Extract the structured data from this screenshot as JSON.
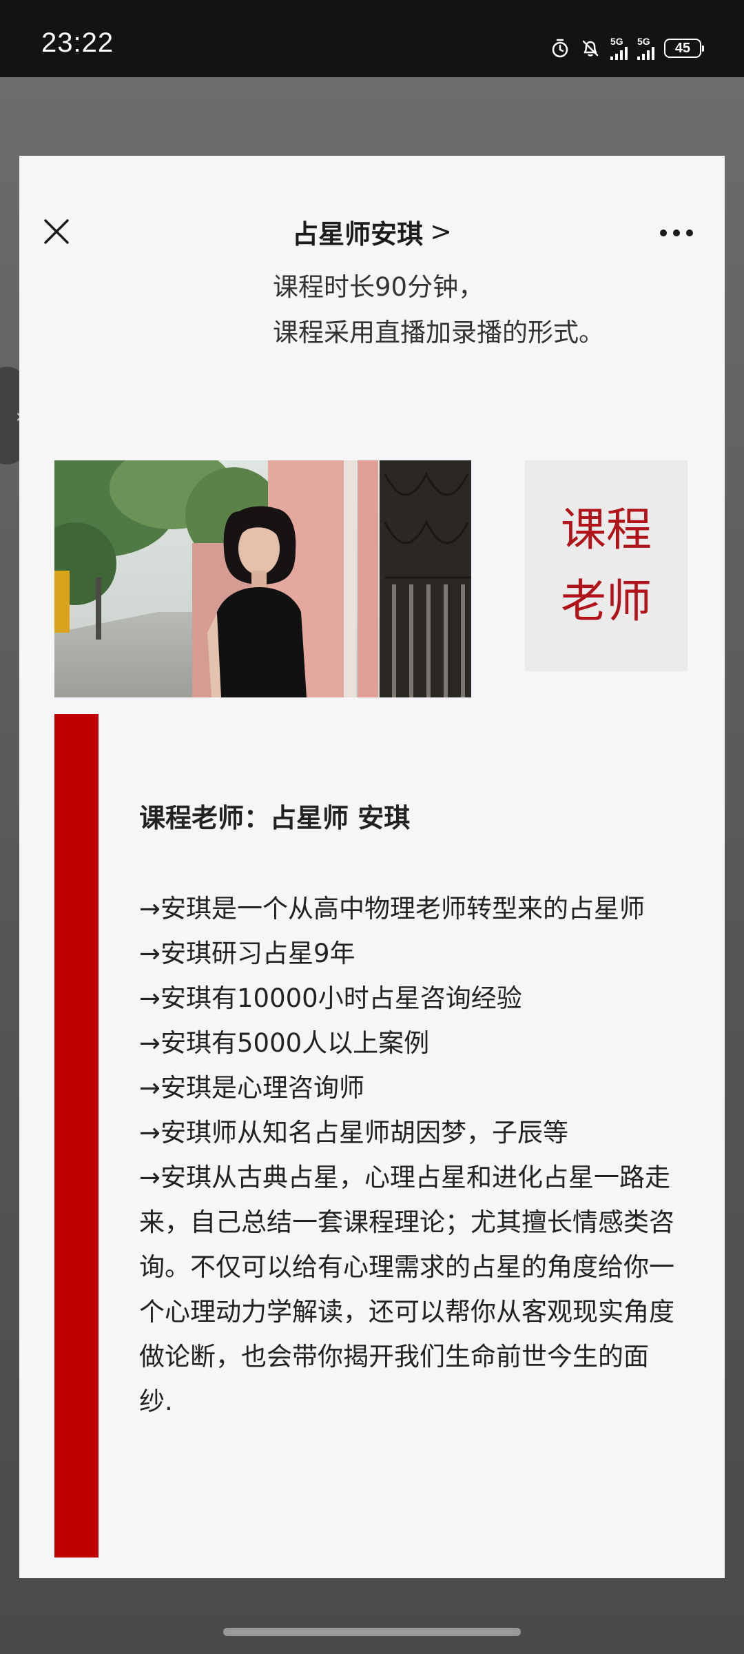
{
  "status_bar": {
    "time": "23:22",
    "network_1": "5G",
    "network_2": "5G",
    "battery": "45",
    "icons": [
      "alarm-icon",
      "mute-icon",
      "signal-icon",
      "battery-icon"
    ]
  },
  "nav": {
    "close_icon": "close-icon",
    "title": "占星师安琪",
    "title_chevron": ">",
    "more_icon": "more-dots-icon"
  },
  "intro": {
    "lines": [
      "课程时长90分钟，",
      "课程采用直播加录播的形式。"
    ]
  },
  "label_card": {
    "line1": "课程",
    "line2": "老师"
  },
  "bio": {
    "heading": "课程老师：占星师 安琪",
    "items": [
      "→安琪是一个从高中物理老师转型来的占星师",
      "→安琪研习占星9年",
      "→安琪有10000小时占星咨询经验",
      "→安琪有5000人以上案例",
      "→安琪是心理咨询师",
      "→安琪师从知名占星师胡因梦，子辰等",
      "→安琪从古典占星，心理占星和进化占星一路走来，自己总结一套课程理论；尤其擅长情感类咨询。不仅可以给有心理需求的占星的角度给你一个心理动力学解读，还可以帮你从客观现实角度做论断，也会带你揭开我们生命前世今生的面纱."
    ]
  },
  "colors": {
    "accent_red": "#c00000",
    "label_red": "#b0141a",
    "sheet_bg": "#f6f6f8",
    "status_bg": "#131313"
  }
}
